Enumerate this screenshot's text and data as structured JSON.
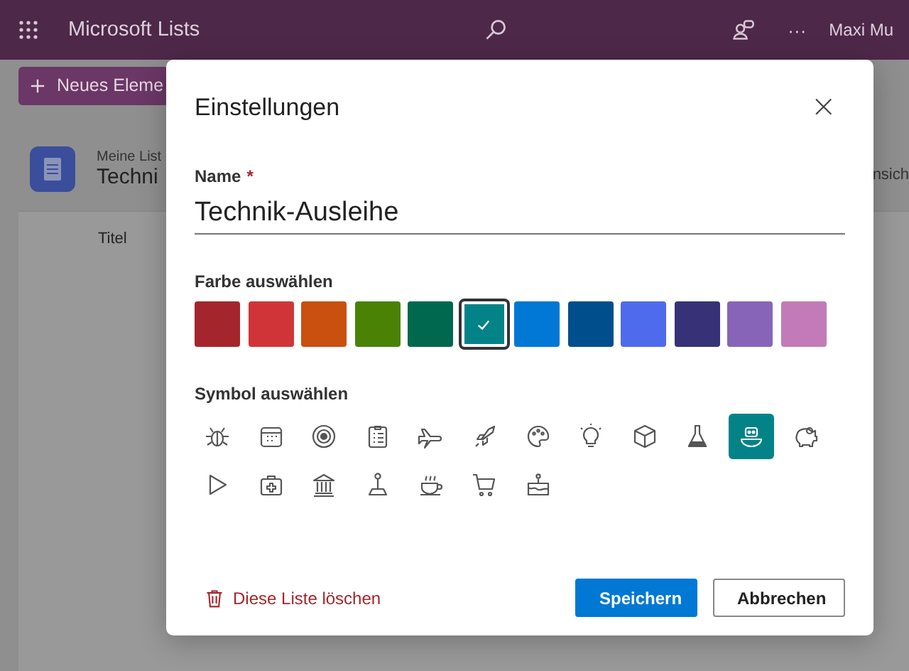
{
  "top_bar": {
    "app_name": "Microsoft Lists",
    "more": "···",
    "user": "Maxi Mu"
  },
  "command_bar": {
    "new_button": "Neues Eleme"
  },
  "list_header": {
    "breadcrumb": "Meine List",
    "title": "Techni",
    "view_label": "nsich"
  },
  "table": {
    "columns": [
      "Titel"
    ]
  },
  "dialog": {
    "title": "Einstellungen",
    "close": "×",
    "name_field": {
      "label": "Name",
      "required_mark": "*",
      "value": "Technik-Ausleihe"
    },
    "color_label": "Farbe auswählen",
    "colors": [
      {
        "color": "#a4262c",
        "selected": false
      },
      {
        "color": "#d13438",
        "selected": false
      },
      {
        "color": "#ca5010",
        "selected": false
      },
      {
        "color": "#498205",
        "selected": false
      },
      {
        "color": "#00684f",
        "selected": false
      },
      {
        "color": "#038387",
        "selected": true
      },
      {
        "color": "#0078d4",
        "selected": false
      },
      {
        "color": "#004e8c",
        "selected": false
      },
      {
        "color": "#4f6bed",
        "selected": false
      },
      {
        "color": "#373277",
        "selected": false
      },
      {
        "color": "#8764b8",
        "selected": false
      },
      {
        "color": "#c27bb8",
        "selected": false
      }
    ],
    "symbol_label": "Symbol auswählen",
    "symbols": [
      {
        "selected": false
      },
      {
        "selected": false
      },
      {
        "selected": false
      },
      {
        "selected": false
      },
      {
        "selected": false
      },
      {
        "selected": false
      },
      {
        "selected": false
      },
      {
        "selected": false
      },
      {
        "selected": false
      },
      {
        "selected": false
      },
      {
        "selected": true
      },
      {
        "selected": false
      },
      {
        "selected": false
      },
      {
        "selected": false
      },
      {
        "selected": false
      },
      {
        "selected": false
      },
      {
        "selected": false
      },
      {
        "selected": false
      },
      {
        "selected": false
      }
    ],
    "delete_link": "Diese Liste löschen",
    "buttons": [
      {
        "label": "Speichern",
        "kind": "primary"
      },
      {
        "label": "Abbrechen",
        "kind": "secondary"
      }
    ]
  }
}
